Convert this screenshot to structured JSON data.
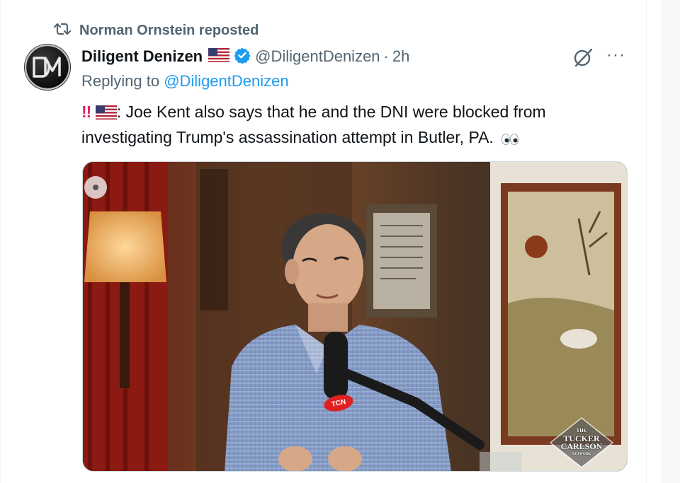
{
  "repost": {
    "icon": "repost-icon",
    "label": "Norman Ornstein reposted"
  },
  "tweet": {
    "display_name": "Diligent Denizen",
    "handle": "@DiligentDenizen",
    "separator": "·",
    "time": "2h",
    "reply_prefix": "Replying to ",
    "reply_handle": "@DiligentDenizen",
    "text_prefix": "!!",
    "text_body": ": Joe Kent also says that he and the DNI were blocked from investigating Trump's assassination attempt in Butler, PA.",
    "more_label": "···"
  },
  "media": {
    "watermark_the": "THE",
    "watermark_line1": "TUCKER",
    "watermark_line2": "CARLSON",
    "watermark_sub": "NETWORK",
    "mic_badge": "TCN"
  },
  "colors": {
    "accent": "#1d9bf0",
    "muted": "#536471",
    "text": "#0f1419",
    "alert": "#e0245e"
  },
  "icons": [
    "repost-icon",
    "us-flag-icon",
    "verified-badge-icon",
    "grok-icon",
    "more-icon",
    "eyes-emoji-icon",
    "double-exclamation-icon"
  ]
}
